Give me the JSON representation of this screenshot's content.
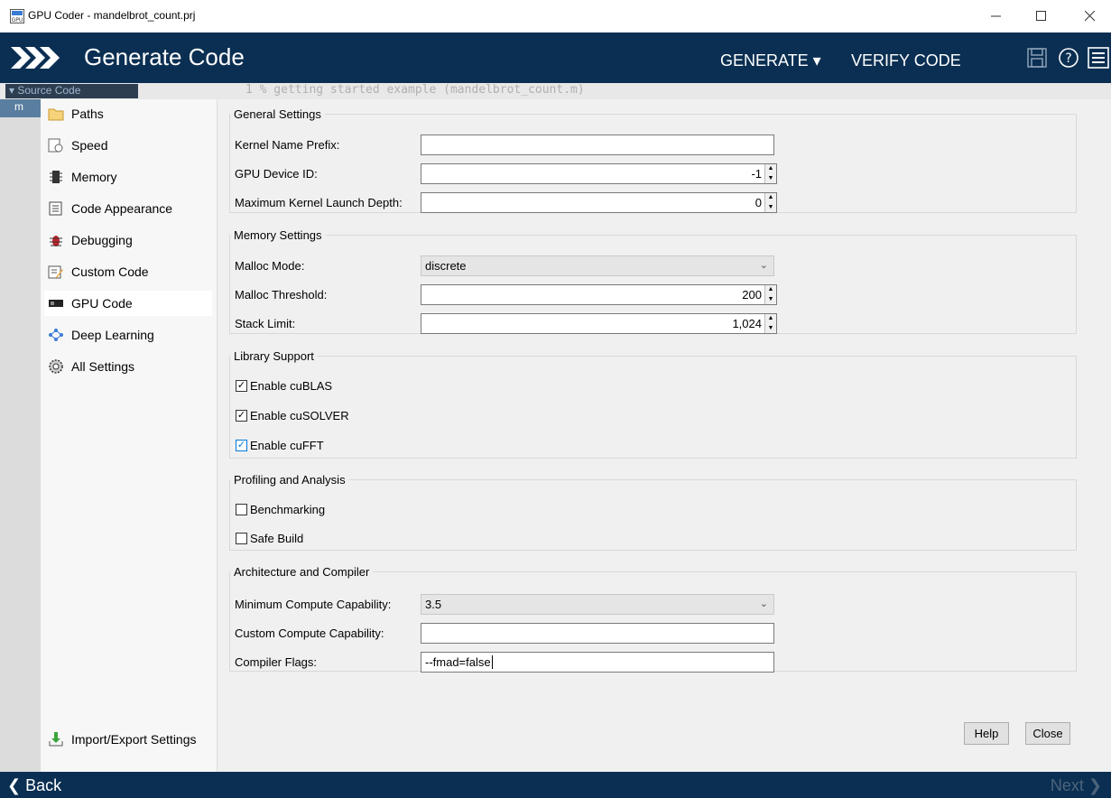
{
  "window": {
    "title": "GPU Coder - mandelbrot_count.prj",
    "app_icon_text": "GPU"
  },
  "header": {
    "title": "Generate Code",
    "generate_label": "GENERATE ▾",
    "verify_label": "VERIFY CODE"
  },
  "source": {
    "label": "▾ Source Code",
    "code_line": "1  % getting started example (mandelbrot_count.m)",
    "file_tab": "m"
  },
  "nav": {
    "items": [
      {
        "label": "Paths",
        "icon": "folder-icon"
      },
      {
        "label": "Speed",
        "icon": "speed-icon"
      },
      {
        "label": "Memory",
        "icon": "memory-chip-icon"
      },
      {
        "label": "Code Appearance",
        "icon": "code-appearance-icon"
      },
      {
        "label": "Debugging",
        "icon": "bug-icon"
      },
      {
        "label": "Custom Code",
        "icon": "custom-code-icon"
      },
      {
        "label": "GPU Code",
        "icon": "gpu-card-icon"
      },
      {
        "label": "Deep Learning",
        "icon": "neural-network-icon"
      },
      {
        "label": "All Settings",
        "icon": "gear-icon"
      }
    ],
    "selected": "GPU Code",
    "import_export": "Import/Export Settings"
  },
  "general": {
    "legend": "General Settings",
    "kernel_prefix_label": "Kernel Name Prefix:",
    "kernel_prefix_value": "",
    "device_id_label": "GPU Device ID:",
    "device_id_value": "-1",
    "launch_depth_label": "Maximum Kernel Launch Depth:",
    "launch_depth_value": "0"
  },
  "memory": {
    "legend": "Memory Settings",
    "malloc_mode_label": "Malloc Mode:",
    "malloc_mode_value": "discrete",
    "malloc_threshold_label": "Malloc Threshold:",
    "malloc_threshold_value": "200",
    "stack_limit_label": "Stack Limit:",
    "stack_limit_value": "1,024"
  },
  "library": {
    "legend": "Library Support",
    "cublas_label": "Enable cuBLAS",
    "cublas_checked": true,
    "cusolver_label": "Enable cuSOLVER",
    "cusolver_checked": true,
    "cufft_label": "Enable cuFFT",
    "cufft_checked": true
  },
  "profiling": {
    "legend": "Profiling and Analysis",
    "benchmarking_label": "Benchmarking",
    "benchmarking_checked": false,
    "safe_build_label": "Safe Build",
    "safe_build_checked": false
  },
  "arch": {
    "legend": "Architecture and Compiler",
    "min_cc_label": "Minimum Compute Capability:",
    "min_cc_value": "3.5",
    "custom_cc_label": "Custom Compute Capability:",
    "custom_cc_value": "",
    "flags_label": "Compiler Flags:",
    "flags_value": "--fmad=false"
  },
  "buttons": {
    "help": "Help",
    "close": "Close"
  },
  "footer": {
    "back": "❮ Back",
    "next": "Next ❯"
  },
  "colors": {
    "header_bg": "#0b2f52",
    "accent_check": "#0078d7"
  }
}
